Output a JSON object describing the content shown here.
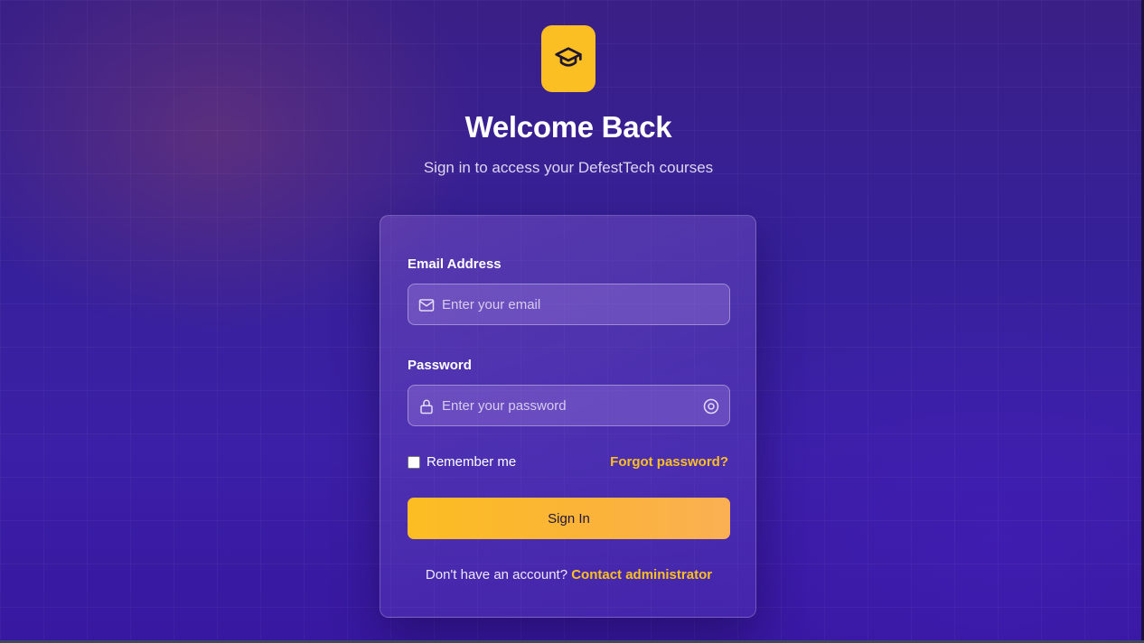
{
  "header": {
    "title": "Welcome Back",
    "subtitle": "Sign in to access your DefestTech courses",
    "logo_icon": "graduation-cap-icon"
  },
  "form": {
    "email": {
      "label": "Email Address",
      "placeholder": "Enter your email",
      "value": "",
      "icon": "mail-icon"
    },
    "password": {
      "label": "Password",
      "placeholder": "Enter your password",
      "value": "",
      "icon": "lock-icon",
      "toggle_icon": "eye-icon"
    },
    "remember_label": "Remember me",
    "remember_checked": false,
    "forgot_label": "Forgot password?",
    "submit_label": "Sign In",
    "footer_text": "Don't have an account?",
    "footer_link": "Contact administrator"
  },
  "colors": {
    "accent": "#fbbf24",
    "background": "#3a1f96",
    "text": "#ffffff"
  }
}
